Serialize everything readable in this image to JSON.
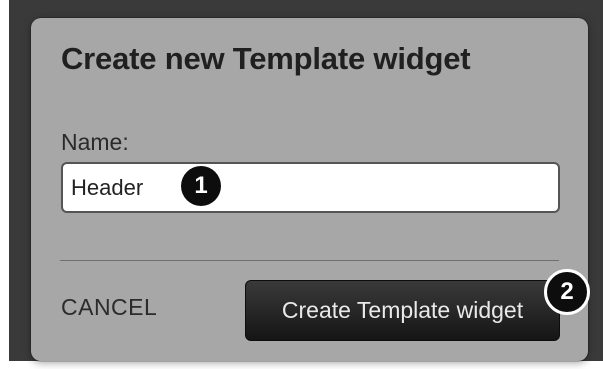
{
  "dialog": {
    "title": "Create new Template widget",
    "name_label": "Name:",
    "name_value": "Header",
    "cancel_label": "CANCEL",
    "create_label": "Create Template widget"
  },
  "callouts": [
    "1",
    "2"
  ],
  "colors": {
    "backdrop": "#3a3a3a",
    "dialog_background": "#a7a7a7",
    "primary_button": "#1f1f1f",
    "callout": "#0d0d0d"
  }
}
